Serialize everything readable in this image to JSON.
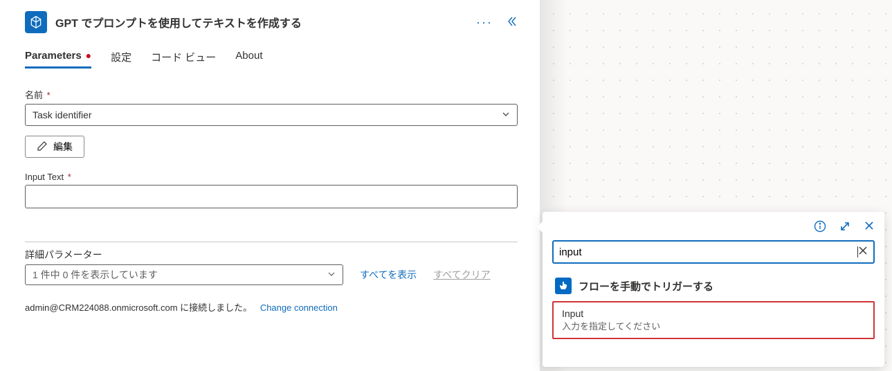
{
  "header": {
    "title": "GPT でプロンプトを使用してテキストを作成する"
  },
  "tabs": {
    "parameters": "Parameters",
    "settings": "設定",
    "codeview": "コード ビュー",
    "about": "About"
  },
  "fields": {
    "name_label": "名前",
    "name_value": "Task identifier",
    "edit_label": "編集",
    "input_text_label": "Input Text"
  },
  "advanced": {
    "label": "詳細パラメーター",
    "select_text": "1 件中 0 件を表示しています",
    "show_all": "すべてを表示",
    "clear_all": "すべてクリア"
  },
  "connection": {
    "status": "admin@CRM224088.onmicrosoft.com に接続しました。",
    "change": "Change connection"
  },
  "dynamic": {
    "search_value": "input",
    "trigger_label": "フローを手動でトリガーする",
    "result_title": "Input",
    "result_sub": "入力を指定してください"
  }
}
